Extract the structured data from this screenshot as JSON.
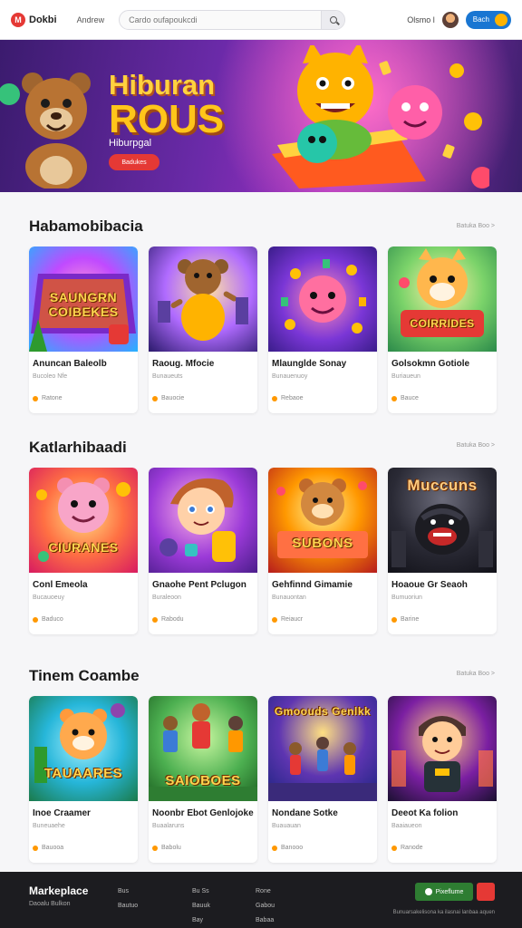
{
  "header": {
    "logo_mark": "M",
    "logo_text": "Dokbi",
    "nav_link": "Andrew",
    "search_placeholder": "Cardo oufapoukcdi",
    "lang": "Olsmo l",
    "cta": "Bach"
  },
  "hero": {
    "title_line1": "Hiburan",
    "title_line2": "ROUS",
    "subtitle": "Hiburpgal",
    "button": "Badukes"
  },
  "sections": [
    {
      "title": "Habamobibacia",
      "link": "Batuka Boo >",
      "cards": [
        {
          "art_label": "SAUNGRN COIBEKES",
          "title": "Anuncan Baleolb",
          "sub": "Bucoleo Nfe",
          "meta": "Ratone"
        },
        {
          "art_label": "",
          "title": "Raoug. Mfocie",
          "sub": "Bunaueuts",
          "meta": "Bauocie"
        },
        {
          "art_label": "",
          "title": "Mlaunglde Sonay",
          "sub": "Bunauenuoy",
          "meta": "Rebaoe"
        },
        {
          "art_label": "COIRRIDES",
          "title": "Golsokmn Gotiole",
          "sub": "Buriaueun",
          "meta": "Bauce"
        }
      ]
    },
    {
      "title": "Katlarhibaadi",
      "link": "Batuka Boo >",
      "cards": [
        {
          "art_label": "CIURANES",
          "title": "Conl Emeola",
          "sub": "Bucauoeuy",
          "meta": "Baduco"
        },
        {
          "art_label": "",
          "title": "Gnaohe Pent Pclugon",
          "sub": "Buraleoon",
          "meta": "Rabodu"
        },
        {
          "art_label": "SUBONS",
          "title": "Gehfinnd Gimamie",
          "sub": "Bunauontan",
          "meta": "Reiaucr"
        },
        {
          "art_label": "Muccuns",
          "title": "Hoaoue Gr Seaoh",
          "sub": "Bumuoriun",
          "meta": "Barine"
        }
      ]
    },
    {
      "title": "Tinem Coambe",
      "link": "Batuka Boo >",
      "cards": [
        {
          "art_label": "TAUAARES",
          "title": "Inoe Craamer",
          "sub": "Buneuaehe",
          "meta": "Bauooa"
        },
        {
          "art_label": "SAIOBOES",
          "title": "Noonbr Ebot Genlojoke",
          "sub": "Buaalaruns",
          "meta": "Babolu"
        },
        {
          "art_label": "Gmoouds Genlkk",
          "title": "Nondane Sotke",
          "sub": "Buauauan",
          "meta": "Banooo"
        },
        {
          "art_label": "",
          "title": "Deeot Ka folion",
          "sub": "Baaiaueon",
          "meta": "Ranode"
        }
      ]
    }
  ],
  "footer": {
    "brand": "Markeplace",
    "brand_sub": "Daoalu Bulkon",
    "col1": [
      "Bus",
      "Bautuo"
    ],
    "col2": [
      "Bu Ss",
      "Bauuk",
      "Bay"
    ],
    "col3": [
      "Rone",
      "Gabou",
      "Babaa"
    ],
    "app_label": "Pixeflume",
    "copyright": "Bunuarsakelisona ka ilasnai lanbaa aquen"
  },
  "colors": {
    "accent": "#e53935",
    "primary": "#1976d2",
    "hero_gold": "#ffc51a"
  }
}
